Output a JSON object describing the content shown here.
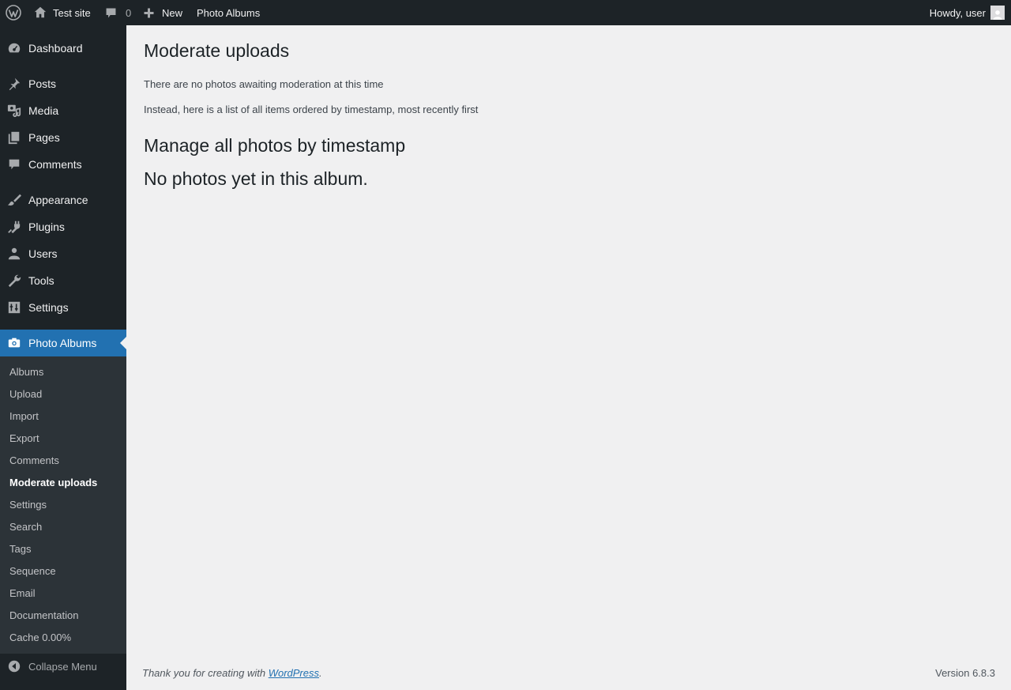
{
  "adminbar": {
    "site_name": "Test site",
    "comments_count": "0",
    "new_label": "New",
    "photo_albums_label": "Photo Albums",
    "howdy": "Howdy, user"
  },
  "sidebar": {
    "items": [
      {
        "label": "Dashboard",
        "icon": "dashboard-icon"
      },
      {
        "label": "Posts",
        "icon": "pushpin-icon"
      },
      {
        "label": "Media",
        "icon": "media-icon"
      },
      {
        "label": "Pages",
        "icon": "pages-icon"
      },
      {
        "label": "Comments",
        "icon": "comment-icon"
      },
      {
        "label": "Appearance",
        "icon": "paintbrush-icon"
      },
      {
        "label": "Plugins",
        "icon": "plugin-icon"
      },
      {
        "label": "Users",
        "icon": "users-icon"
      },
      {
        "label": "Tools",
        "icon": "wrench-icon"
      },
      {
        "label": "Settings",
        "icon": "settings-icon"
      },
      {
        "label": "Photo Albums",
        "icon": "camera-icon",
        "current": true
      }
    ],
    "submenu": [
      "Albums",
      "Upload",
      "Import",
      "Export",
      "Comments",
      "Moderate uploads",
      "Settings",
      "Search",
      "Tags",
      "Sequence",
      "Email",
      "Documentation",
      "Cache 0.00%"
    ],
    "submenu_current": "Moderate uploads",
    "collapse_label": "Collapse Menu"
  },
  "main": {
    "title": "Moderate uploads",
    "para1": "There are no photos awaiting moderation at this time",
    "para2": "Instead, here is a list of all items ordered by timestamp, most recently first",
    "heading_manage": "Manage all photos by timestamp",
    "heading_none": "No photos yet in this album."
  },
  "footer": {
    "thanks_prefix": "Thank you for creating with ",
    "wordpress_link": "WordPress",
    "thanks_suffix": ".",
    "version": "Version 6.8.3"
  },
  "colors": {
    "adminbar_bg": "#1d2327",
    "accent": "#2271b1",
    "submenu_bg": "#2c3338",
    "content_bg": "#f0f0f1"
  }
}
